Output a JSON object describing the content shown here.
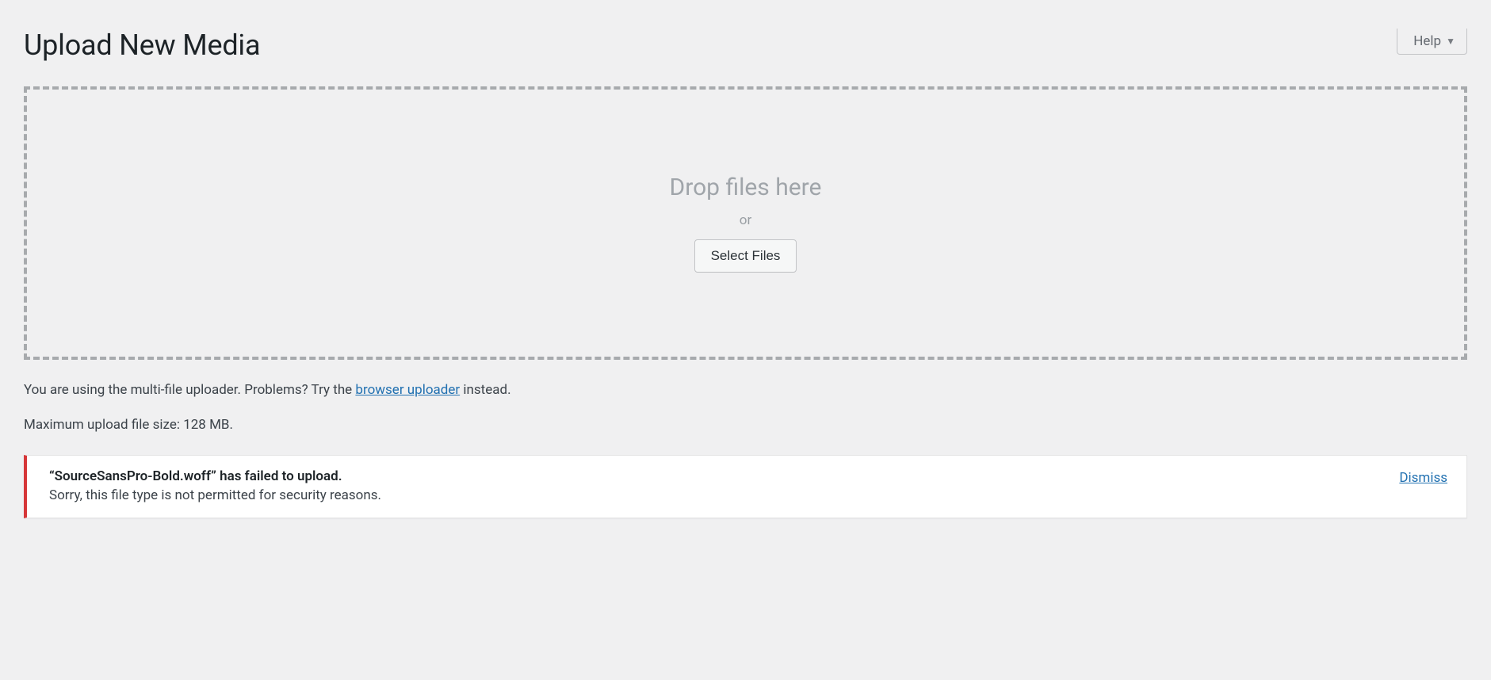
{
  "help": {
    "label": "Help"
  },
  "page": {
    "title": "Upload New Media"
  },
  "dropzone": {
    "heading": "Drop files here",
    "or": "or",
    "button": "Select Files"
  },
  "uploader_info": {
    "prefix": "You are using the multi-file uploader. Problems? Try the ",
    "link_text": "browser uploader",
    "suffix": " instead."
  },
  "max_upload": "Maximum upload file size: 128 MB.",
  "error": {
    "title": "“SourceSansPro-Bold.woff” has failed to upload.",
    "body": "Sorry, this file type is not permitted for security reasons.",
    "dismiss": "Dismiss"
  }
}
